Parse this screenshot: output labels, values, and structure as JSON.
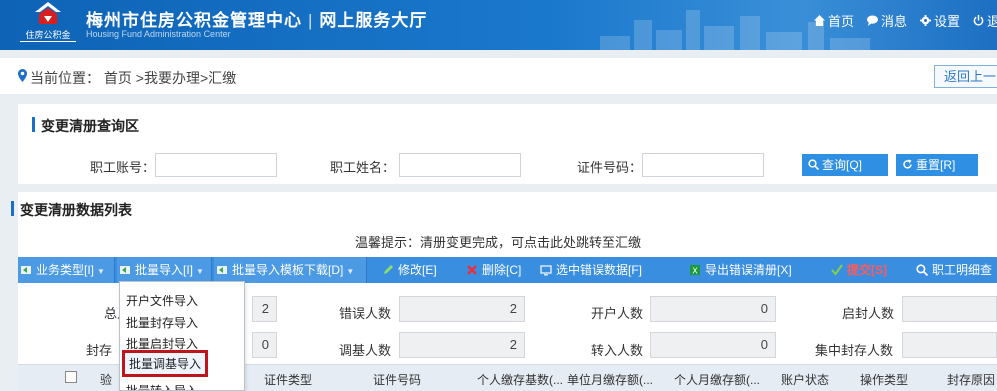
{
  "header": {
    "logo_text": "住房公积金",
    "title": "梅州市住房公积金管理中心",
    "subtitle_divider": "|",
    "portal": "网上服务大厅",
    "subtitle_en": "Housing Fund Administration Center",
    "nav": [
      "首页",
      "消息",
      "设置",
      "退"
    ]
  },
  "breadcrumb": {
    "text": "当前位置： 首页 >我要办理>汇缴",
    "back_label": "返回上一"
  },
  "query": {
    "title": "变更清册查询区",
    "fields": [
      {
        "label": "职工账号：",
        "value": ""
      },
      {
        "label": "职工姓名：",
        "value": ""
      },
      {
        "label": "证件号码：",
        "value": ""
      }
    ],
    "search_label": "查询[Q]",
    "reset_label": "重置[R]"
  },
  "list": {
    "title": "变更清册数据列表",
    "tip": "温馨提示：清册变更完成，可点击此处跳转至汇缴",
    "toolbar": [
      "业务类型[I]",
      "批量导入[I]",
      "批量导入模板下载[D]",
      "修改[E]",
      "删除[C]",
      "选中错误数据[F]",
      "导出错误清册[X]",
      "提交[S]",
      "职工明细查"
    ],
    "stats": [
      {
        "label": "总人",
        "value": "2"
      },
      {
        "label": "错误人数",
        "value": "2"
      },
      {
        "label": "开户人数",
        "value": "0"
      },
      {
        "label": "启封人数",
        "value": ""
      },
      {
        "label": "封存",
        "value": "0"
      },
      {
        "label": "调基人数",
        "value": "2"
      },
      {
        "label": "转入人数",
        "value": "0"
      },
      {
        "label": "集中封存人数",
        "value": ""
      }
    ],
    "columns": [
      "验",
      "证件类型",
      "证件号码",
      "个人缴存基数(...",
      "单位月缴存额(...",
      "个人月缴存额(...",
      "账户状态",
      "操作类型",
      "封存原因"
    ]
  },
  "import_menu": {
    "items": [
      "开户文件导入",
      "批量封存导入",
      "批量启封导入",
      "批量调基导入",
      "批量转入导入"
    ]
  },
  "colors": {
    "brand": "#1a6fc9",
    "toolbar": "#3a8ee0",
    "highlight": "#c0141b"
  }
}
